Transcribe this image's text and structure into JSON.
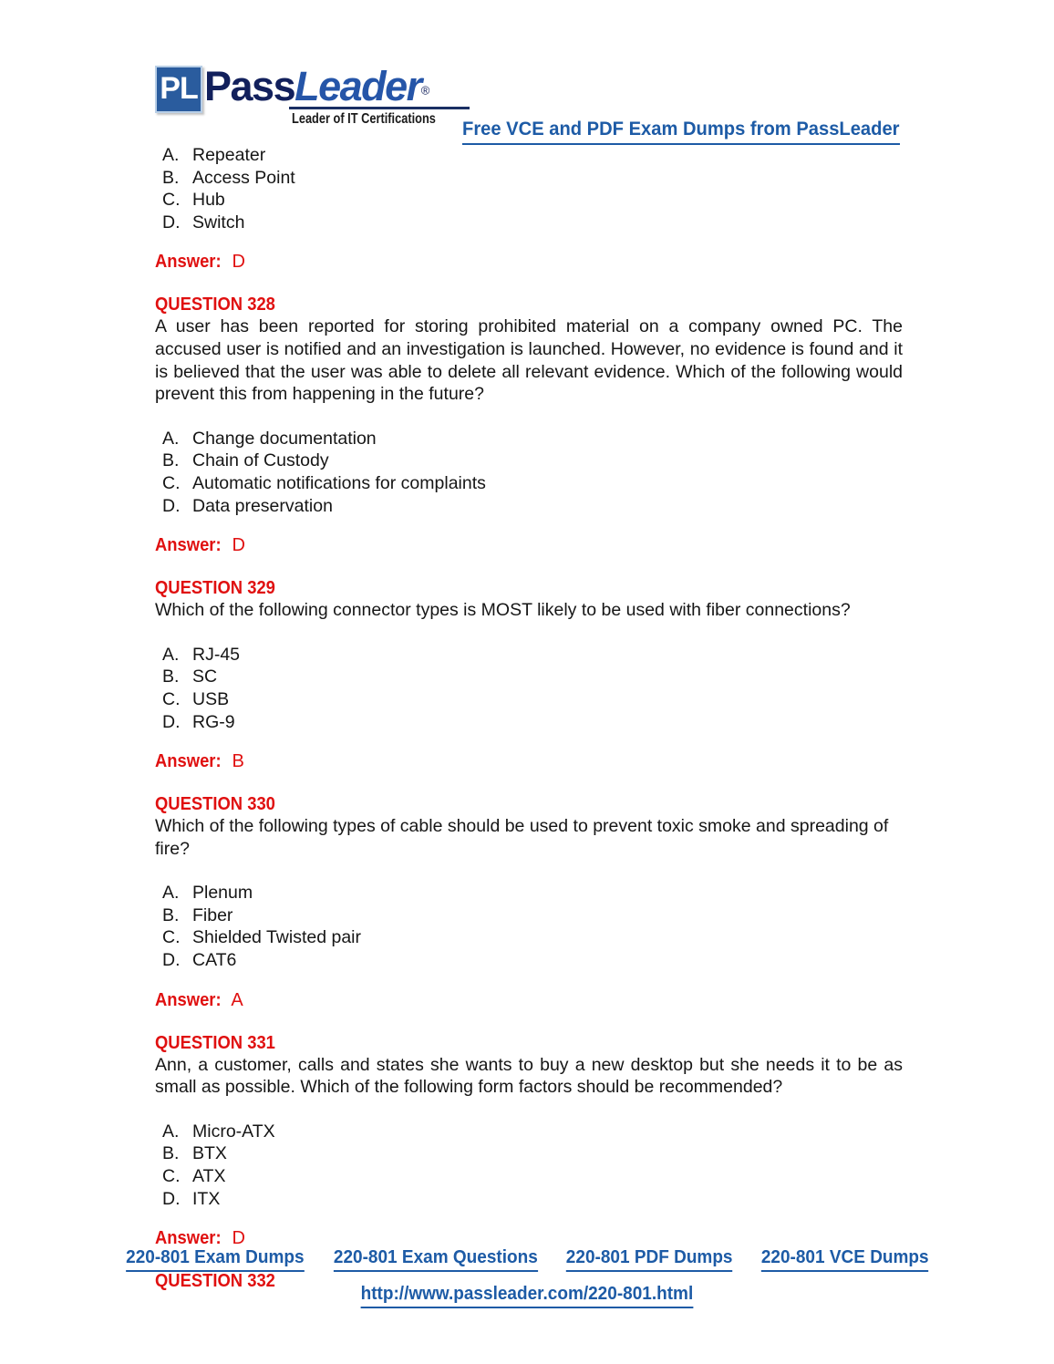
{
  "header": {
    "logo_box_text": "PL",
    "logo_word_1": "Pass",
    "logo_word_2": "Leader",
    "logo_registered": "®",
    "tagline": "Leader of IT Certifications",
    "banner_link": "Free VCE and PDF Exam Dumps from PassLeader",
    "brand_blue": "#1d5ba6",
    "brand_navy": "#12205c",
    "logo_box_blue": "#2a5c9e"
  },
  "colors": {
    "answer_red": "#e01010",
    "body_text": "#161616",
    "link_blue": "#1d5ba6"
  },
  "body": {
    "prev_question_options": [
      {
        "letter": "A.",
        "text": "Repeater"
      },
      {
        "letter": "B.",
        "text": "Access Point"
      },
      {
        "letter": "C.",
        "text": "Hub"
      },
      {
        "letter": "D.",
        "text": "Switch"
      }
    ],
    "prev_answer": {
      "label": "Answer:",
      "value": "D"
    },
    "questions": [
      {
        "heading": "QUESTION 328",
        "text": "A user has been reported for storing prohibited material on a company owned PC. The accused user is notified and an investigation is launched. However, no evidence is found and it is believed that the user was able to delete all relevant evidence. Which of the following would prevent this from happening in the future?",
        "options": [
          {
            "letter": "A.",
            "text": "Change documentation"
          },
          {
            "letter": "B.",
            "text": "Chain of Custody"
          },
          {
            "letter": "C.",
            "text": "Automatic notifications for complaints"
          },
          {
            "letter": "D.",
            "text": "Data preservation"
          }
        ],
        "answer": {
          "label": "Answer:",
          "value": "D"
        }
      },
      {
        "heading": "QUESTION 329",
        "text": "Which of the following connector types is MOST likely to be used with fiber connections?",
        "options": [
          {
            "letter": "A.",
            "text": "RJ-45"
          },
          {
            "letter": "B.",
            "text": "SC"
          },
          {
            "letter": "C.",
            "text": "USB"
          },
          {
            "letter": "D.",
            "text": "RG-9"
          }
        ],
        "answer": {
          "label": "Answer:",
          "value": "B"
        }
      },
      {
        "heading": "QUESTION 330",
        "text": "Which of the following types of cable should be used to prevent toxic smoke and spreading of fire?",
        "options": [
          {
            "letter": "A.",
            "text": "Plenum"
          },
          {
            "letter": "B.",
            "text": "Fiber"
          },
          {
            "letter": "C.",
            "text": "Shielded Twisted pair"
          },
          {
            "letter": "D.",
            "text": "CAT6"
          }
        ],
        "answer": {
          "label": "Answer:",
          "value": "A"
        }
      },
      {
        "heading": "QUESTION 331",
        "text": "Ann, a customer, calls and states she wants to buy a new desktop but she needs it to be as small as possible. Which of the following form factors should be recommended?",
        "options": [
          {
            "letter": "A.",
            "text": "Micro-ATX"
          },
          {
            "letter": "B.",
            "text": "BTX"
          },
          {
            "letter": "C.",
            "text": "ATX"
          },
          {
            "letter": "D.",
            "text": "ITX"
          }
        ],
        "answer": {
          "label": "Answer:",
          "value": "D"
        }
      }
    ],
    "trailing_heading": "QUESTION 332"
  },
  "footer": {
    "links": [
      "220-801 Exam Dumps",
      "220-801 Exam Questions",
      "220-801 PDF Dumps",
      "220-801 VCE Dumps"
    ],
    "url": "http://www.passleader.com/220-801.html"
  }
}
